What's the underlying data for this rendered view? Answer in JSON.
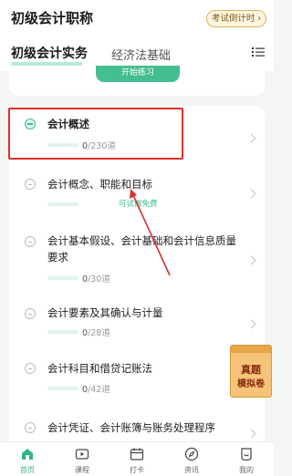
{
  "header": {
    "title": "初级会计职称",
    "exam_countdown": "考试倒计时 ›",
    "tabs": [
      {
        "label": "初级会计实务",
        "active": true
      },
      {
        "label": "经济法基础",
        "active": false
      }
    ]
  },
  "top_card": {
    "button_label": "开始练习"
  },
  "chapters": [
    {
      "title": "会计概述",
      "progress": "0",
      "total": "/230道",
      "expanded": true
    },
    {
      "title": "会计概念、职能和目标",
      "badge": "可试做免费",
      "progress": "",
      "total": ""
    },
    {
      "title": "会计基本假设、会计基础和会计信息质量要求",
      "progress": "0",
      "total": "/30道"
    },
    {
      "title": "会计要素及其确认与计量",
      "progress": "0",
      "total": "/28道"
    },
    {
      "title": "会计科目和借贷记账法",
      "progress": "0",
      "total": "/42道"
    },
    {
      "title": "会计凭证、会计账簿与账务处理程序",
      "progress": "",
      "total": ""
    }
  ],
  "promo": {
    "line1": "真题",
    "line2": "模拟卷"
  },
  "bottom_nav": [
    {
      "label": "首页",
      "icon": "home-icon",
      "active": true
    },
    {
      "label": "课程",
      "icon": "video-icon",
      "active": false
    },
    {
      "label": "打卡",
      "icon": "calendar-icon",
      "active": false
    },
    {
      "label": "资讯",
      "icon": "compass-icon",
      "active": false
    },
    {
      "label": "我的",
      "icon": "profile-icon",
      "active": false
    }
  ],
  "colors": {
    "accent": "#2fb885",
    "highlight": "#e0302c",
    "promo": "#f5c478"
  }
}
